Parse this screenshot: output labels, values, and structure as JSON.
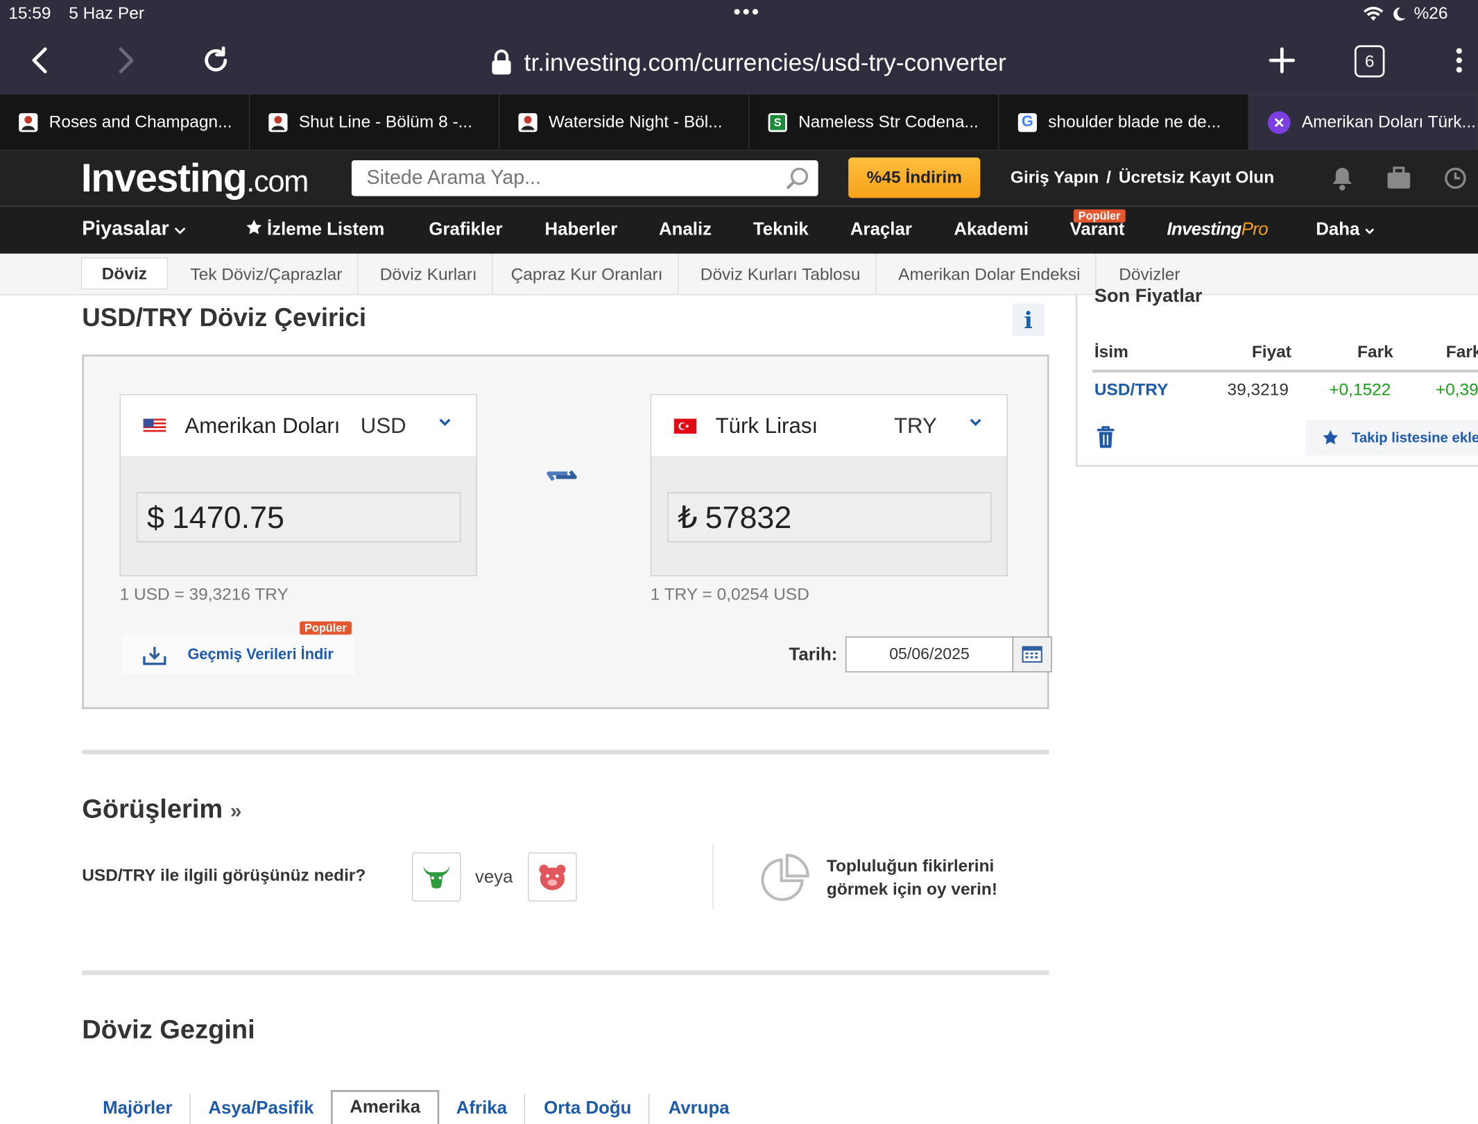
{
  "status": {
    "time": "15:59",
    "date": "5 Haz Per",
    "battery": "%26"
  },
  "browser": {
    "url": "tr.investing.com/currencies/usd-try-converter",
    "tab_count": "6"
  },
  "tabs": [
    {
      "title": "Roses and Champagn..."
    },
    {
      "title": "Shut Line - Bölüm 8 -..."
    },
    {
      "title": "Waterside Night - Böl..."
    },
    {
      "title": "Nameless Str Codena..."
    },
    {
      "title": "shoulder blade ne de..."
    },
    {
      "title": "Amerikan Doları Türk..."
    }
  ],
  "site": {
    "logo_main": "Investing",
    "logo_suffix": ".com",
    "search_placeholder": "Sitede Arama Yap...",
    "promo": "%45 İndirim",
    "login": "Giriş Yapın",
    "login_sep": "/",
    "register": "Ücretsiz Kayıt Olun"
  },
  "nav": {
    "piyasalar": "Piyasalar",
    "watchlist": "İzleme Listem",
    "grafikler": "Grafikler",
    "haberler": "Haberler",
    "analiz": "Analiz",
    "teknik": "Teknik",
    "araclar": "Araçlar",
    "akademi": "Akademi",
    "varant": "Varant",
    "varant_badge": "Popüler",
    "pro_a": "Investing",
    "pro_b": "Pro",
    "daha": "Daha"
  },
  "subnav": {
    "doviz": "Döviz",
    "items": [
      "Tek Döviz/Çaprazlar",
      "Döviz Kurları",
      "Çapraz Kur Oranları",
      "Döviz Kurları Tablosu",
      "Amerikan Dolar Endeksi",
      "Dövizler"
    ]
  },
  "converter": {
    "title": "USD/TRY Döviz Çevirici",
    "info": "i",
    "from": {
      "name": "Amerikan Doları",
      "code": "USD",
      "symbol": "$",
      "amount": "1470.75",
      "rate": "1 USD = 39,3216 TRY"
    },
    "to": {
      "name": "Türk Lirası",
      "code": "TRY",
      "symbol": "₺",
      "amount": "57832",
      "rate": "1 TRY = 0,0254 USD"
    },
    "download_label": "Geçmiş Verileri İndir",
    "download_badge": "Popüler",
    "date_label": "Tarih:",
    "date_value": "05/06/2025"
  },
  "opinions": {
    "title": "Görüşlerim",
    "title_suffix": "»",
    "question": "USD/TRY ile ilgili görüşünüz nedir?",
    "or": "veya",
    "community_line1": "Topluluğun fikirlerini",
    "community_line2": "görmek için oy verin!"
  },
  "explorer": {
    "title": "Döviz Gezgini",
    "tabs": [
      "Majörler",
      "Asya/Pasifik",
      "Amerika",
      "Afrika",
      "Orta Doğu",
      "Avrupa"
    ]
  },
  "side": {
    "title": "Son Fiyatlar",
    "headers": [
      "İsim",
      "Fiyat",
      "Fark",
      "Fark"
    ],
    "row": {
      "name": "USD/TRY",
      "price": "39,3219",
      "change": "+0,1522",
      "change_pct": "+0,39"
    },
    "watch_label": "Takip listesine ekle"
  },
  "colors": {
    "link": "#1e5aa8",
    "positive": "#1a9e1a",
    "promo": "#f7a21b",
    "badge": "#e4572e"
  }
}
